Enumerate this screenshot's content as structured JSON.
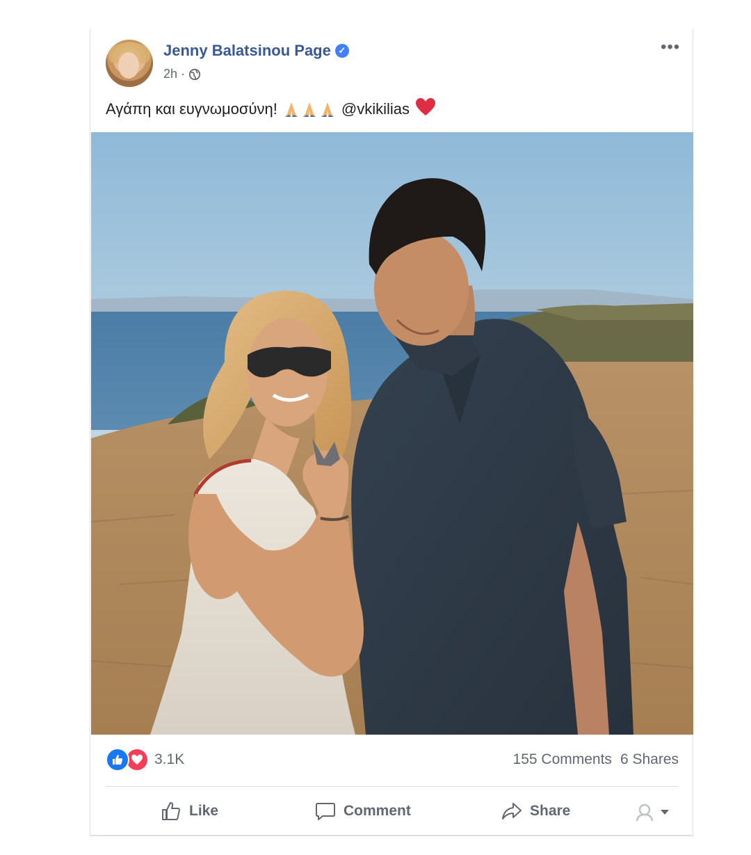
{
  "post": {
    "author": "Jenny Balatsinou Page",
    "time": "2h",
    "separator": "·",
    "text": "Αγάπη και ευγνωμοσύνη!",
    "mention": "@vkikilias",
    "icons": {
      "verified": "verified-badge-icon",
      "privacy": "globe-icon",
      "menu": "more-options-icon",
      "emoji_pray": "folded-hands-emoji",
      "emoji_heart": "red-heart-emoji"
    }
  },
  "stats": {
    "reactions_count": "3.1K",
    "comments": "155 Comments",
    "shares": "6 Shares"
  },
  "actions": {
    "like": "Like",
    "comment": "Comment",
    "share": "Share"
  },
  "colors": {
    "author_link": "#385898",
    "like_blue": "#1877f2",
    "love_red": "#f33e58",
    "muted_text": "#606770"
  }
}
